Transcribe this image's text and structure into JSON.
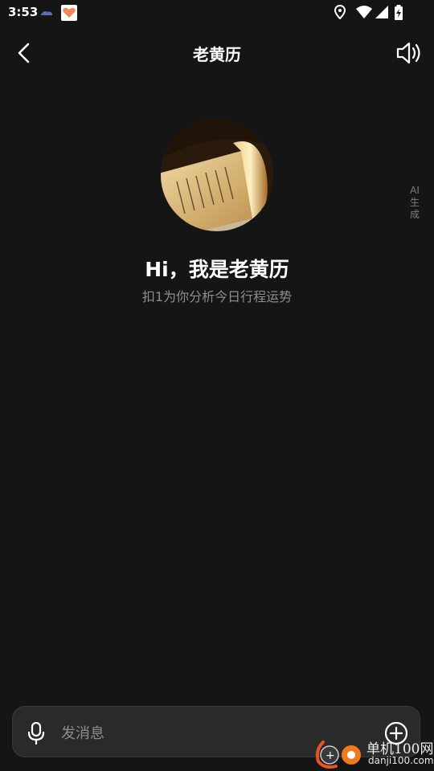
{
  "status_bar": {
    "time": "3:53"
  },
  "header": {
    "title": "老黄历"
  },
  "ai_tag": "AI生成",
  "greeting": "Hi，我是老黄历",
  "subtitle": "扣1为你分析今日行程运势",
  "input": {
    "placeholder": "发消息"
  },
  "watermark": {
    "title": "单机100网",
    "url": "danji100.com"
  },
  "icons": [
    "back-icon",
    "speaker-icon",
    "mic-icon",
    "plus-circle-icon",
    "location-icon",
    "wifi-icon",
    "signal-icon",
    "battery-icon"
  ],
  "colors": {
    "background": "#151515",
    "input_bar": "#2a2a2a",
    "subtitle_text": "#8e8e8e"
  }
}
